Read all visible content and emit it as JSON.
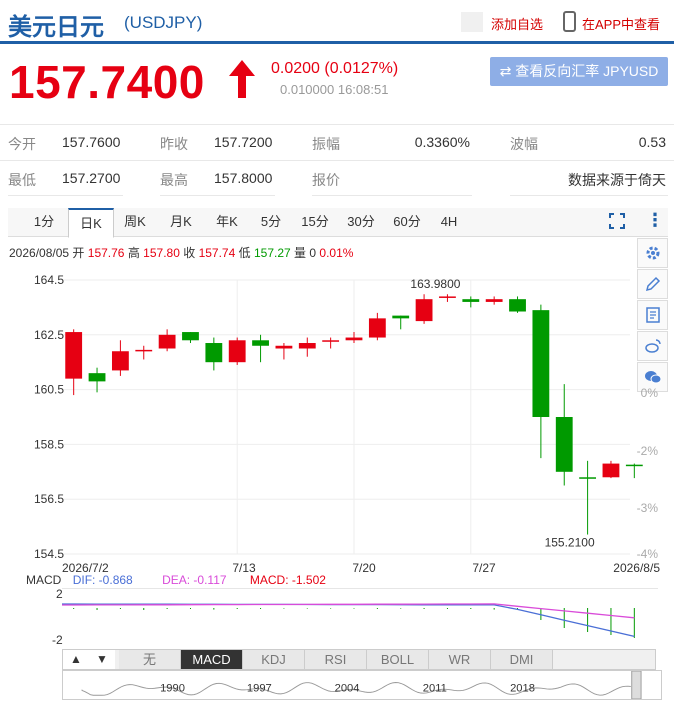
{
  "header": {
    "name": "美元日元",
    "code": "(USDJPY)",
    "add_fav": "添加自选",
    "app_view": "在APP中查看"
  },
  "quote": {
    "price": "157.7400",
    "change": "0.0200 (0.0127%)",
    "sub": "0.010000 16:08:51",
    "reverse_btn": "⇄ 查看反向汇率 JPYUSD",
    "direction": "up"
  },
  "info": {
    "open_label": "今开",
    "open": "157.7600",
    "prev_label": "昨收",
    "prev": "157.7200",
    "amp_label": "振幅",
    "amp": "0.3360%",
    "wave_label": "波幅",
    "wave": "0.53",
    "low_label": "最低",
    "low": "157.2700",
    "high_label": "最高",
    "high": "157.8000",
    "bid_label": "报价",
    "source": "数据来源于倚天"
  },
  "period_tabs": [
    "1分",
    "日K",
    "周K",
    "月K",
    "年K",
    "5分",
    "15分",
    "30分",
    "60分",
    "4H"
  ],
  "active_tab": "日K",
  "ohlc": {
    "date": "2026/08/05",
    "open_label": "开",
    "open": "157.76",
    "high_label": "高",
    "high": "157.80",
    "close_label": "收",
    "close": "157.74",
    "low_label": "低",
    "low": "157.27",
    "vol_label": "量",
    "vol": "0",
    "pct": "0.01%"
  },
  "macd": {
    "label": "MACD",
    "dif": "DIF: -0.868",
    "dea": "DEA: -0.117",
    "macd": "MACD: -1.502",
    "axis_top": "2",
    "axis_bottom": "-2"
  },
  "indicator_nav": [
    "▲",
    "▼"
  ],
  "indicators": [
    "无",
    "MACD",
    "KDJ",
    "RSI",
    "BOLL",
    "WR",
    "DMI"
  ],
  "active_indicator": "MACD",
  "overview_years": [
    "1990",
    "1997",
    "2004",
    "2011",
    "2018"
  ],
  "colors": {
    "up": "#e60012",
    "down": "#009a00",
    "accent": "#1f5fa6"
  },
  "chart_data": {
    "type": "candlestick",
    "y_ticks": [
      "164.5",
      "162.5",
      "160.5",
      "158.5",
      "156.5",
      "154.5"
    ],
    "ylim": [
      154.5,
      164.5
    ],
    "pct_ticks": [
      "0%",
      "-2%",
      "-3%",
      "-4%"
    ],
    "x_labels": [
      "2026/7/2",
      "7/13",
      "7/20",
      "7/27",
      "2026/8/5"
    ],
    "max_label": "163.9800",
    "min_label": "155.2100",
    "candles": [
      {
        "o": 160.9,
        "h": 162.7,
        "l": 160.3,
        "c": 162.6
      },
      {
        "o": 161.1,
        "h": 161.3,
        "l": 160.4,
        "c": 160.8
      },
      {
        "o": 161.2,
        "h": 162.3,
        "l": 161.0,
        "c": 161.9
      },
      {
        "o": 161.9,
        "h": 162.1,
        "l": 161.6,
        "c": 161.95
      },
      {
        "o": 162.0,
        "h": 162.7,
        "l": 161.9,
        "c": 162.5
      },
      {
        "o": 162.6,
        "h": 162.6,
        "l": 162.2,
        "c": 162.3
      },
      {
        "o": 162.2,
        "h": 162.4,
        "l": 161.2,
        "c": 161.5
      },
      {
        "o": 161.5,
        "h": 162.4,
        "l": 161.4,
        "c": 162.3
      },
      {
        "o": 162.3,
        "h": 162.5,
        "l": 161.5,
        "c": 162.1
      },
      {
        "o": 162.0,
        "h": 162.2,
        "l": 161.6,
        "c": 162.1
      },
      {
        "o": 162.0,
        "h": 162.4,
        "l": 161.7,
        "c": 162.2
      },
      {
        "o": 162.25,
        "h": 162.4,
        "l": 162.0,
        "c": 162.3
      },
      {
        "o": 162.3,
        "h": 162.6,
        "l": 162.2,
        "c": 162.4
      },
      {
        "o": 162.4,
        "h": 163.3,
        "l": 162.3,
        "c": 163.1
      },
      {
        "o": 163.2,
        "h": 163.2,
        "l": 162.7,
        "c": 163.1
      },
      {
        "o": 163.0,
        "h": 163.98,
        "l": 162.9,
        "c": 163.8
      },
      {
        "o": 163.85,
        "h": 163.98,
        "l": 163.7,
        "c": 163.9
      },
      {
        "o": 163.8,
        "h": 163.9,
        "l": 163.5,
        "c": 163.7
      },
      {
        "o": 163.7,
        "h": 163.9,
        "l": 163.6,
        "c": 163.8
      },
      {
        "o": 163.8,
        "h": 163.9,
        "l": 163.3,
        "c": 163.35
      },
      {
        "o": 163.4,
        "h": 163.6,
        "l": 158.0,
        "c": 159.5
      },
      {
        "o": 159.5,
        "h": 160.7,
        "l": 157.0,
        "c": 157.5
      },
      {
        "o": 157.3,
        "h": 157.9,
        "l": 155.21,
        "c": 157.25
      },
      {
        "o": 157.3,
        "h": 157.9,
        "l": 157.27,
        "c": 157.8
      },
      {
        "o": 157.76,
        "h": 157.8,
        "l": 157.27,
        "c": 157.74
      }
    ],
    "macd_hist": [
      -0.05,
      -0.1,
      -0.05,
      -0.1,
      -0.05,
      -0.05,
      -0.08,
      -0.05,
      -0.05,
      -0.03,
      -0.03,
      -0.03,
      -0.03,
      -0.05,
      -0.03,
      -0.05,
      -0.05,
      -0.05,
      -0.08,
      -0.1,
      -0.6,
      -1.0,
      -1.2,
      -1.35,
      -1.5
    ]
  }
}
